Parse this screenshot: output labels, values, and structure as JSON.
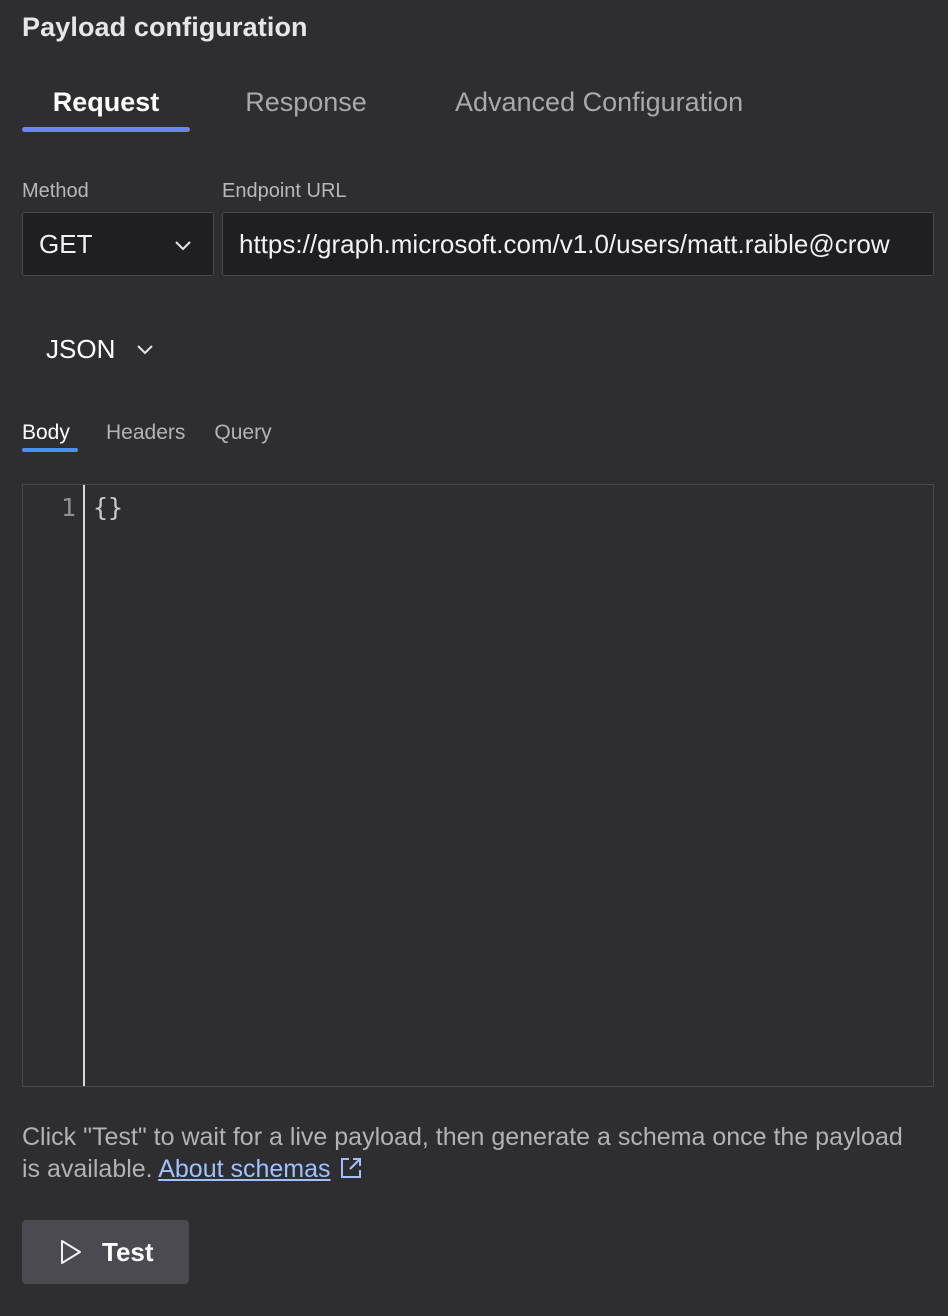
{
  "panel": {
    "title": "Payload configuration"
  },
  "tabs": {
    "request": "Request",
    "response": "Response",
    "advanced": "Advanced Configuration",
    "active": "Request"
  },
  "request": {
    "method_label": "Method",
    "method_value": "GET",
    "url_label": "Endpoint URL",
    "url_value": "https://graph.microsoft.com/v1.0/users/matt.raible@crow",
    "format_value": "JSON"
  },
  "subtabs": {
    "body": "Body",
    "headers": "Headers",
    "query": "Query",
    "active": "Body"
  },
  "editor": {
    "line_numbers": [
      "1"
    ],
    "lines": [
      "{}"
    ]
  },
  "help": {
    "text": "Click \"Test\" to wait for a live payload, then generate a schema once the payload is available.",
    "link": "About schemas"
  },
  "actions": {
    "test_label": "Test"
  },
  "colors": {
    "background": "#2e2e31",
    "tab_accent": "#6a86f2",
    "subtab_accent": "#4d8ff5",
    "link": "#9fc2ff"
  },
  "icons": {
    "method_dropdown": "chevron-down-icon",
    "format_dropdown": "chevron-down-icon",
    "link_icon": "external-link-icon",
    "test_icon": "play-icon"
  }
}
